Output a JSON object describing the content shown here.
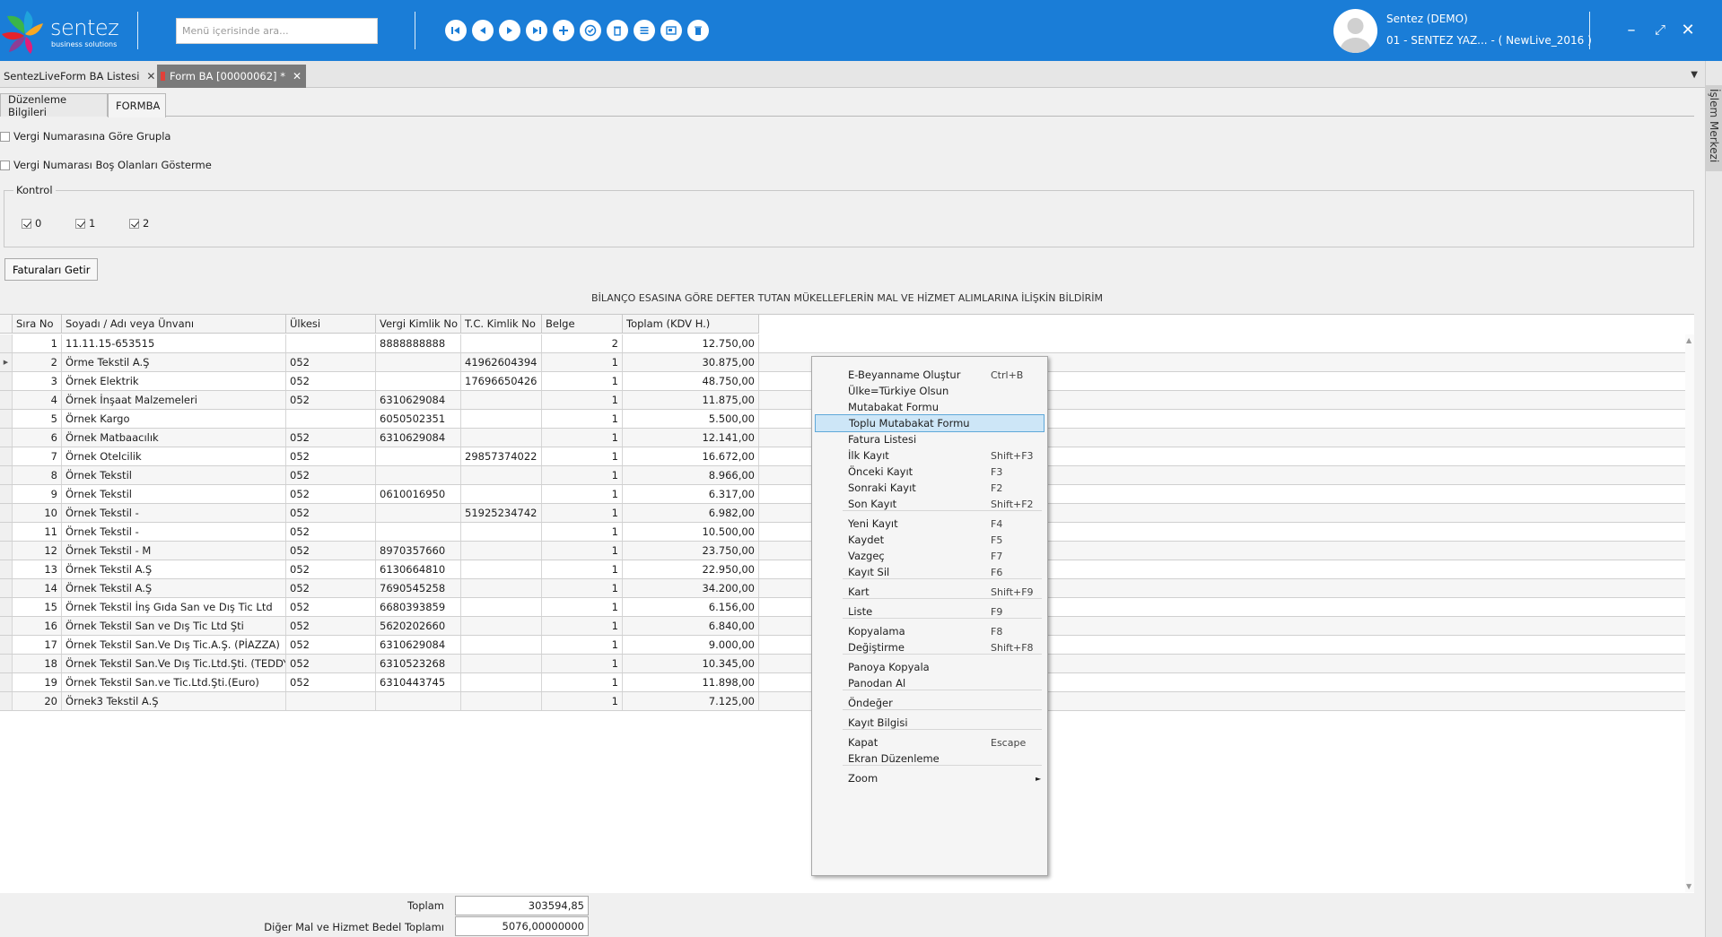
{
  "brand": {
    "name": "sentez",
    "tagline": "business solutions"
  },
  "search": {
    "placeholder": "Menü içerisinde ara..."
  },
  "toolbar": {
    "buttons": [
      "first-record-icon",
      "previous-record-icon",
      "next-record-icon",
      "last-record-icon",
      "new-record-icon",
      "save-icon",
      "delete-icon",
      "list-icon",
      "preview-icon",
      "trash-icon"
    ]
  },
  "user": {
    "name": "Sentez (DEMO)",
    "company": "01 - SENTEZ YAZ... - ( NewLive_2016 )"
  },
  "window": {
    "minimize": "–",
    "restore": "⤢",
    "close": "✕"
  },
  "tabs": [
    {
      "label": "SentezLive"
    },
    {
      "label": "Form BA Listesi"
    },
    {
      "label": "Form BA [00000062]  *"
    }
  ],
  "side_panel": {
    "label": "İşlem Merkezi"
  },
  "subtabs": [
    "Düzenleme Bilgileri",
    "FORMBA"
  ],
  "options": {
    "group_by_tax": "Vergi Numarasına Göre Grupla",
    "hide_empty_tax": "Vergi Numarası Boş Olanları Gösterme"
  },
  "kontrol": {
    "legend": "Kontrol",
    "items": [
      "0",
      "1",
      "2"
    ]
  },
  "fetch_button": "Faturaları Getir",
  "report_title": "BİLANÇO ESASINA GÖRE DEFTER TUTAN MÜKELLEFLERİN MAL VE HİZMET ALIMLARINA İLİŞKİN BİLDİRİM",
  "grid": {
    "columns": [
      "Sıra No",
      "Soyadı / Adı veya Ünvanı",
      "Ülkesi",
      "Vergi Kimlik No",
      "T.C. Kimlik No",
      "Belge",
      "Toplam (KDV H.)"
    ],
    "rows": [
      [
        "1",
        "11.11.15-653515",
        "",
        "8888888888",
        "",
        "2",
        "12.750,00"
      ],
      [
        "2",
        "Örme Tekstil A.Ş",
        "052",
        "",
        "41962604394",
        "1",
        "30.875,00"
      ],
      [
        "3",
        "Örnek Elektrik",
        "052",
        "",
        "17696650426",
        "1",
        "48.750,00"
      ],
      [
        "4",
        "Örnek İnşaat Malzemeleri",
        "052",
        "6310629084",
        "",
        "1",
        "11.875,00"
      ],
      [
        "5",
        "Örnek Kargo",
        "",
        "6050502351",
        "",
        "1",
        "5.500,00"
      ],
      [
        "6",
        "Örnek Matbaacılık",
        "052",
        "6310629084",
        "",
        "1",
        "12.141,00"
      ],
      [
        "7",
        "Örnek Otelcilik",
        "052",
        "",
        "29857374022",
        "1",
        "16.672,00"
      ],
      [
        "8",
        "Örnek Tekstil",
        "052",
        "",
        "",
        "1",
        "8.966,00"
      ],
      [
        "9",
        "Örnek Tekstil",
        "052",
        "0610016950",
        "",
        "1",
        "6.317,00"
      ],
      [
        "10",
        "Örnek Tekstil -",
        "052",
        "",
        "51925234742",
        "1",
        "6.982,00"
      ],
      [
        "11",
        "Örnek Tekstil -",
        "052",
        "",
        "",
        "1",
        "10.500,00"
      ],
      [
        "12",
        "Örnek Tekstil - M",
        "052",
        "8970357660",
        "",
        "1",
        "23.750,00"
      ],
      [
        "13",
        "Örnek Tekstil A.Ş",
        "052",
        "6130664810",
        "",
        "1",
        "22.950,00"
      ],
      [
        "14",
        "Örnek Tekstil A.Ş",
        "052",
        "7690545258",
        "",
        "1",
        "34.200,00"
      ],
      [
        "15",
        "Örnek Tekstil İnş Gıda San ve Dış Tic Ltd",
        "052",
        "6680393859",
        "",
        "1",
        "6.156,00"
      ],
      [
        "16",
        "Örnek Tekstil San ve Dış Tic Ltd Şti",
        "052",
        "5620202660",
        "",
        "1",
        "6.840,00"
      ],
      [
        "17",
        "Örnek Tekstil San.Ve Dış Tic.A.Ş. (PİAZZA)",
        "052",
        "6310629084",
        "",
        "1",
        "9.000,00"
      ],
      [
        "18",
        "Örnek Tekstil San.Ve Dış Tic.Ltd.Şti. (TEDDY)",
        "052",
        "6310523268",
        "",
        "1",
        "10.345,00"
      ],
      [
        "19",
        "Örnek Tekstil San.ve Tic.Ltd.Şti.(Euro)",
        "052",
        "6310443745",
        "",
        "1",
        "11.898,00"
      ],
      [
        "20",
        "Örnek3 Tekstil A.Ş",
        "",
        "",
        "",
        "1",
        "7.125,00"
      ]
    ]
  },
  "totals": {
    "total_label": "Toplam",
    "total_value": "303594,85",
    "other_label": "Diğer Mal ve Hizmet Bedel Toplamı",
    "other_value": "5076,00000000"
  },
  "context_menu": {
    "items": [
      {
        "label": "E-Beyanname Oluştur",
        "shortcut": "Ctrl+B"
      },
      {
        "label": "Ülke=Türkiye Olsun",
        "shortcut": ""
      },
      {
        "label": "Mutabakat Formu",
        "shortcut": ""
      },
      {
        "label": "Toplu Mutabakat Formu",
        "shortcut": ""
      },
      {
        "label": "Fatura Listesi",
        "shortcut": ""
      },
      {
        "label": "İlk Kayıt",
        "shortcut": "Shift+F3"
      },
      {
        "label": "Önceki Kayıt",
        "shortcut": "F3"
      },
      {
        "label": "Sonraki Kayıt",
        "shortcut": "F2"
      },
      {
        "label": "Son Kayıt",
        "shortcut": "Shift+F2"
      },
      {
        "label": "Yeni Kayıt",
        "shortcut": "F4"
      },
      {
        "label": "Kaydet",
        "shortcut": "F5"
      },
      {
        "label": "Vazgeç",
        "shortcut": "F7"
      },
      {
        "label": "Kayıt Sil",
        "shortcut": "F6"
      },
      {
        "label": "Kart",
        "shortcut": "Shift+F9"
      },
      {
        "label": "Liste",
        "shortcut": "F9"
      },
      {
        "label": "Kopyalama",
        "shortcut": "F8"
      },
      {
        "label": "Değiştirme",
        "shortcut": "Shift+F8"
      },
      {
        "label": "Panoya Kopyala",
        "shortcut": ""
      },
      {
        "label": "Panodan Al",
        "shortcut": ""
      },
      {
        "label": "Öndeğer",
        "shortcut": ""
      },
      {
        "label": "Kayıt Bilgisi",
        "shortcut": ""
      },
      {
        "label": "Kapat",
        "shortcut": "Escape"
      },
      {
        "label": "Ekran Düzenleme",
        "shortcut": ""
      },
      {
        "label": "Zoom",
        "shortcut": ""
      }
    ],
    "highlighted": "Toplu Mutabakat Formu"
  },
  "colors": {
    "header": "#1a7dd7",
    "menu_highlight": "#cde6f7",
    "active_tab": "#7a7a7a"
  }
}
